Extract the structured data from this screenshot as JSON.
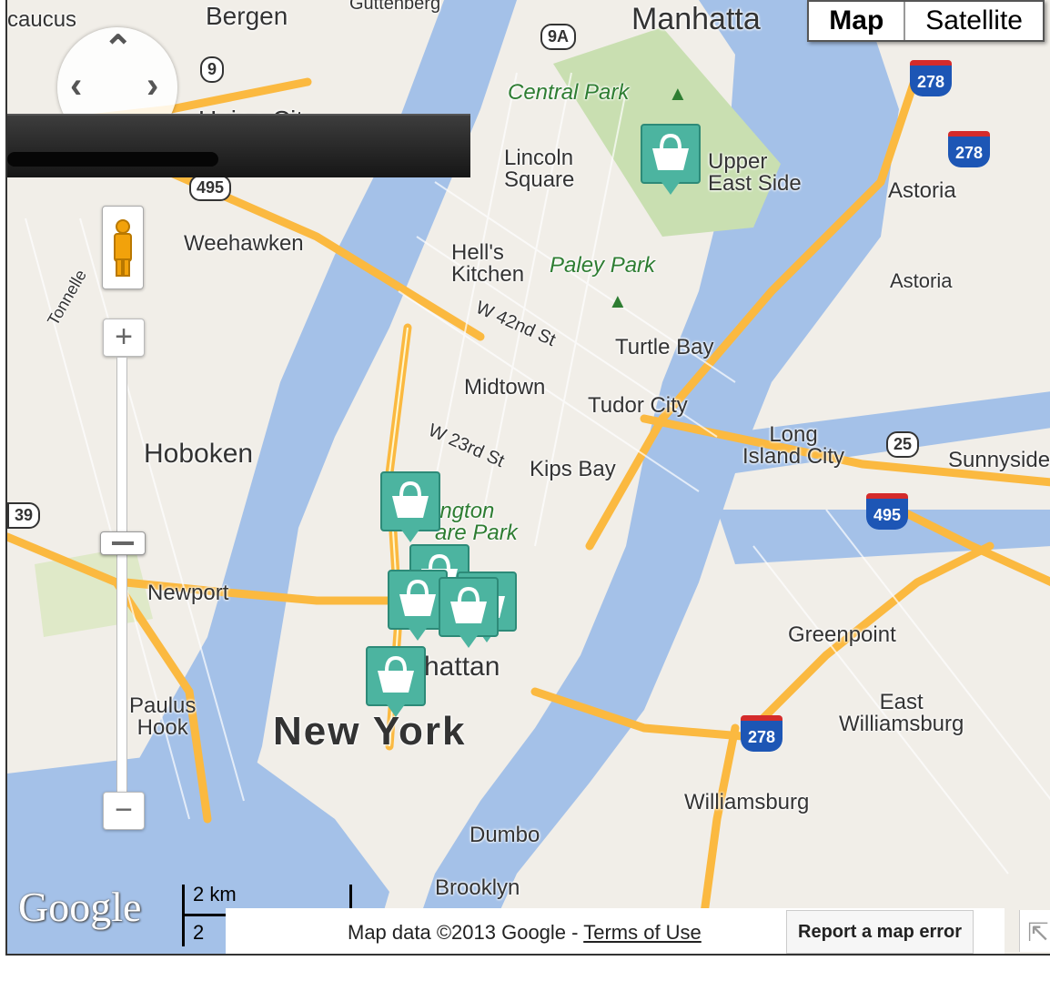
{
  "map_type": {
    "map_label": "Map",
    "satellite_label": "Satellite",
    "active": "Map"
  },
  "labels": {
    "caucus": "caucus",
    "bergen": "Bergen",
    "guttenberg": "Guttenberg",
    "manhattan_top": "Manhatta",
    "union_city": "Union City",
    "central_park": "Central Park",
    "lincoln_square": "Lincoln\nSquare",
    "upper_east_side": "Upper\nEast Side",
    "astoria1": "Astoria",
    "astoria2": "Astoria",
    "weehawken": "Weehawken",
    "tonnelle": "Tonnelle",
    "hells_kitchen": "Hell's\nKitchen",
    "paley_park": "Paley Park",
    "w42": "W 42nd St",
    "turtle_bay": "Turtle Bay",
    "midtown": "Midtown",
    "tudor_city": "Tudor City",
    "long_island_city": "Long\nIsland City",
    "sunnyside": "Sunnyside",
    "hoboken": "Hoboken",
    "w23": "W 23rd St",
    "kips_bay": "Kips Bay",
    "wash_sq": "ington\nare Park",
    "newport": "Newport",
    "greenpoint": "Greenpoint",
    "manhattan": "hattan",
    "paulus_hook": "Paulus\nHook",
    "new_york": "New York",
    "east_williamsburg": "East\nWilliamsburg",
    "williamsburg": "Williamsburg",
    "dumbo": "Dumbo",
    "brooklyn": "Brooklyn"
  },
  "shields": {
    "s9a": "9A",
    "s9": "9",
    "s495": "495",
    "s39": "39",
    "s25": "25"
  },
  "interstates": {
    "i278a": "278",
    "i278b": "278",
    "i495": "495",
    "i278c": "278"
  },
  "scale": {
    "km": "2 km",
    "mi": "2"
  },
  "google_logo": "Google",
  "footer": {
    "map_data": "Map data ©2013 Google - ",
    "terms": "Terms of Use",
    "report": "Report a map error"
  },
  "marker_icon": "handbag-icon",
  "colors": {
    "water": "#a4c1e8",
    "land": "#f1eee8",
    "park": "#c9dfb1",
    "highway": "#fbb940",
    "marker": "#4cb4a0"
  }
}
